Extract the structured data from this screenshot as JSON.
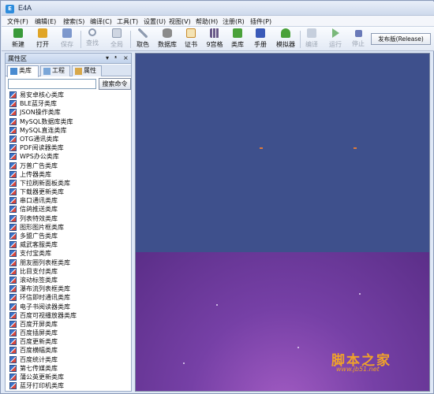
{
  "window": {
    "title": "E4A",
    "icon": "app-icon"
  },
  "menu": [
    "文件(F)",
    "编辑(E)",
    "搜索(S)",
    "编译(C)",
    "工具(T)",
    "设置(U)",
    "视图(V)",
    "帮助(H)",
    "注册(R)",
    "插件(P)"
  ],
  "toolbar": {
    "buttons": [
      {
        "label": "新建",
        "icon": "new-file-icon",
        "color": "#3a9a3a",
        "enabled": true
      },
      {
        "label": "打开",
        "icon": "open-folder-icon",
        "color": "#e0a527",
        "enabled": true
      },
      {
        "label": "保存",
        "icon": "save-icon",
        "color": "#4a6fb8",
        "enabled": false
      },
      {
        "label": "查找",
        "icon": "find-icon",
        "color": "#8e9bb0",
        "enabled": false
      },
      {
        "label": "全局",
        "icon": "global-search-icon",
        "color": "#8e9bb0",
        "enabled": false
      },
      {
        "label": "取色",
        "icon": "color-picker-icon",
        "color": "#8e9bb0",
        "enabled": true
      },
      {
        "label": "数据库",
        "icon": "database-icon",
        "color": "#8b8b8b",
        "enabled": true
      },
      {
        "label": "证书",
        "icon": "certificate-icon",
        "color": "#c98b2a",
        "enabled": true
      },
      {
        "label": "9宫格",
        "icon": "nine-grid-icon",
        "color": "#6a5a8a",
        "enabled": true
      },
      {
        "label": "类库",
        "icon": "library-icon",
        "color": "#4aa13a",
        "enabled": true
      },
      {
        "label": "手册",
        "icon": "manual-icon",
        "color": "#3a5ab8",
        "enabled": true
      },
      {
        "label": "模拟器",
        "icon": "emulator-icon",
        "color": "#4aa13a",
        "enabled": true
      },
      {
        "label": "编译",
        "icon": "compile-icon",
        "color": "#8e9bb0",
        "enabled": false
      },
      {
        "label": "运行",
        "icon": "run-icon",
        "color": "#7ab87a",
        "enabled": false
      },
      {
        "label": "停止",
        "icon": "stop-icon",
        "color": "#6a7ab8",
        "enabled": false
      }
    ],
    "build_mode": "发布版(Release)"
  },
  "panel": {
    "title": "属性区",
    "controls": [
      "▾",
      "ᵜ",
      "×"
    ],
    "tabs": [
      {
        "label": "类库",
        "icon": "library-tab-icon",
        "active": true
      },
      {
        "label": "工程",
        "icon": "project-tab-icon",
        "active": false
      },
      {
        "label": "属性",
        "icon": "properties-tab-icon",
        "active": false
      }
    ],
    "search": {
      "value": "",
      "button": "搜索命令"
    },
    "items": [
      "易安卓核心类库",
      "BLE蓝牙类库",
      "JSON操作类库",
      "MySQL数据库类库",
      "MySQL直连类库",
      "OTG通讯类库",
      "PDF阅读器类库",
      "WPS办公类库",
      "万普广告类库",
      "上传器类库",
      "下拉刷新面板类库",
      "下载器更新类库",
      "串口通讯类库",
      "信鸽推送类库",
      "列表特效类库",
      "图形图片框类库",
      "多盟广告类库",
      "威武客服类库",
      "支付宝类库",
      "朋友圈列表框类库",
      "比目支付类库",
      "滚动标签类库",
      "瀑布流列表框类库",
      "环信即时通讯类库",
      "电子书阅读器类库",
      "百度可视播放器类库",
      "百度开屏类库",
      "百度插屏类库",
      "百度更新类库",
      "百度横幅类库",
      "百度统计类库",
      "第七传媒类库",
      "蒲公英更新类库",
      "蓝牙打印机类库"
    ]
  },
  "watermark": {
    "text": "脚本之家",
    "url": "www.jb51.net"
  }
}
